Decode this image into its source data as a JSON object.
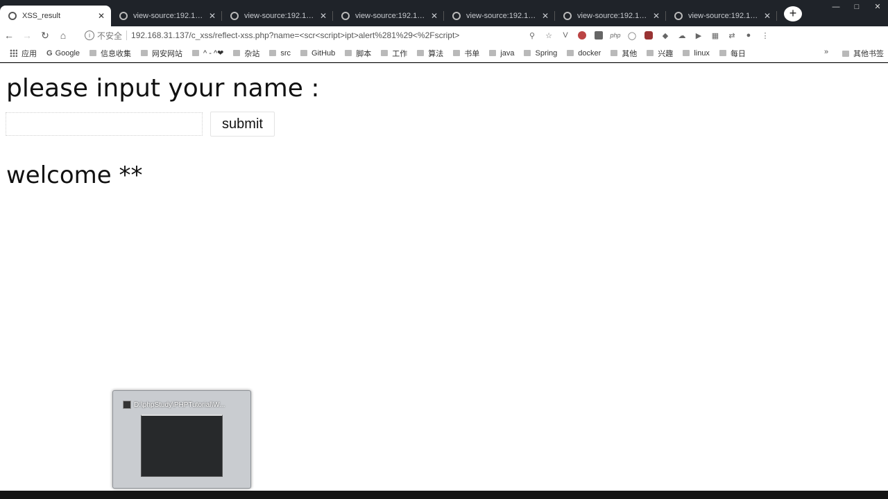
{
  "browser": {
    "tabs": [
      {
        "title": "XSS_result",
        "active": true
      },
      {
        "title": "view-source:192.168.",
        "active": false
      },
      {
        "title": "view-source:192.168.",
        "active": false
      },
      {
        "title": "view-source:192.168.",
        "active": false
      },
      {
        "title": "view-source:192.168.",
        "active": false
      },
      {
        "title": "view-source:192.168.",
        "active": false
      },
      {
        "title": "view-source:192.168.",
        "active": false
      }
    ],
    "new_tab": "+",
    "security_label": "不安全",
    "url": "192.168.31.137/c_xss/reflect-xss.php?name=<scr<script>ipt>alert%281%29<%2Fscript>",
    "bookmarks": [
      {
        "label": "应用",
        "type": "apps"
      },
      {
        "label": "Google",
        "type": "google"
      },
      {
        "label": "信息收集",
        "type": "folder"
      },
      {
        "label": "网安网站",
        "type": "folder"
      },
      {
        "label": "^ - ^❤",
        "type": "folder"
      },
      {
        "label": "杂站",
        "type": "folder"
      },
      {
        "label": "src",
        "type": "folder"
      },
      {
        "label": "GitHub",
        "type": "folder"
      },
      {
        "label": "脚本",
        "type": "folder"
      },
      {
        "label": "工作",
        "type": "folder"
      },
      {
        "label": "算法",
        "type": "folder"
      },
      {
        "label": "书单",
        "type": "folder"
      },
      {
        "label": "java",
        "type": "folder"
      },
      {
        "label": "Spring",
        "type": "folder"
      },
      {
        "label": "docker",
        "type": "folder"
      },
      {
        "label": "其他",
        "type": "folder"
      },
      {
        "label": "兴趣",
        "type": "folder"
      },
      {
        "label": "linux",
        "type": "folder"
      },
      {
        "label": "每日",
        "type": "folder"
      }
    ],
    "bookmarks_more": "»",
    "other_bookmarks": "其他书签"
  },
  "page": {
    "heading": "please input your name :",
    "input_value": "",
    "submit_label": "submit",
    "welcome": "welcome **"
  },
  "taskbar_preview": {
    "title": "D:\\phpStudy\\PHPTutorial\\W..."
  }
}
